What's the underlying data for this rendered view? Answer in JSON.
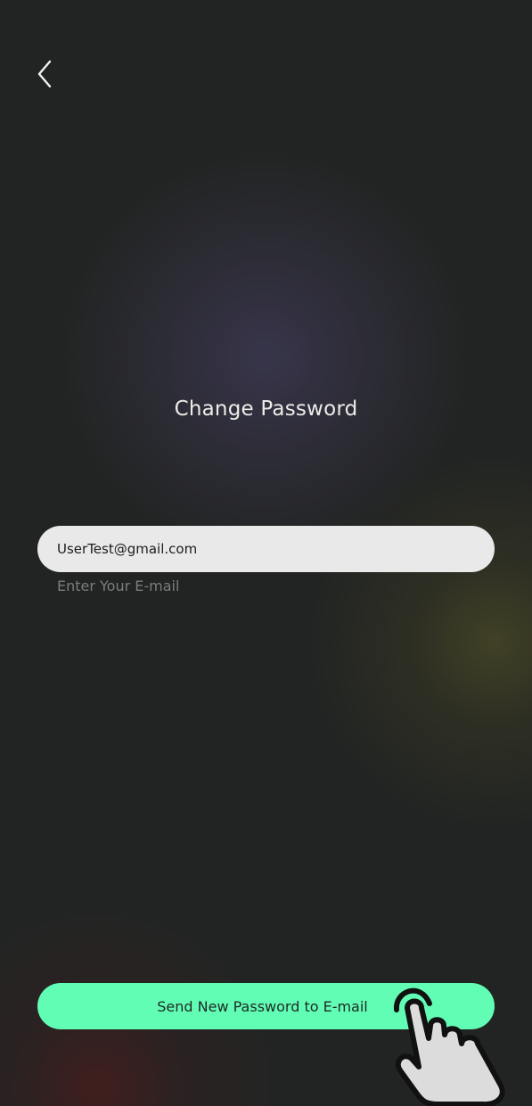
{
  "screen": {
    "title": "Change Password"
  },
  "email": {
    "value": "UserTest@gmail.com",
    "hint": "Enter Your E-mail"
  },
  "actions": {
    "send_label": "Send New Password to E-mail"
  },
  "icons": {
    "back": "chevron-left-icon",
    "pointer": "hand-pointer-icon"
  },
  "colors": {
    "background": "#222423",
    "accent": "#62fdb5",
    "field_background": "#e9e9e9",
    "title_text": "#ecece8",
    "hint_text": "#7b7d7c"
  }
}
